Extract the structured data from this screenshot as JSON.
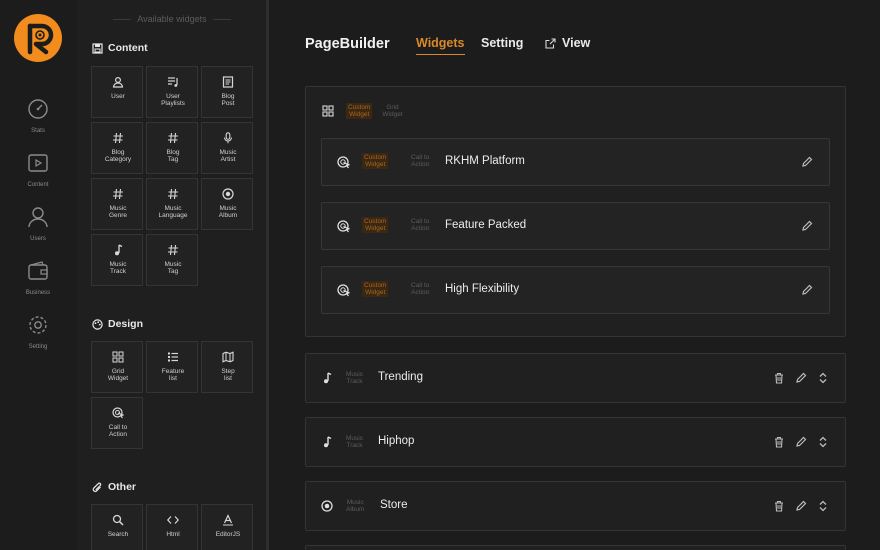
{
  "nav": {
    "items": [
      {
        "label": "Stats",
        "icon": "gauge-icon"
      },
      {
        "label": "Content",
        "icon": "video-icon"
      },
      {
        "label": "Users",
        "icon": "user-icon"
      },
      {
        "label": "Business",
        "icon": "wallet-icon"
      },
      {
        "label": "Setting",
        "icon": "gear-icon"
      }
    ]
  },
  "sidebar": {
    "title": "Available widgets",
    "categories": [
      {
        "label": "Content",
        "tiles": [
          {
            "label": "User",
            "icon": "user-icon"
          },
          {
            "label": "User\nPlaylists",
            "icon": "playlist-icon"
          },
          {
            "label": "Blog\nPost",
            "icon": "newspaper-icon"
          },
          {
            "label": "Blog\nCategory",
            "icon": "hash-icon"
          },
          {
            "label": "Blog\nTag",
            "icon": "hash-icon"
          },
          {
            "label": "Music\nArtist",
            "icon": "mic-icon"
          },
          {
            "label": "Music\nGenre",
            "icon": "hash-icon"
          },
          {
            "label": "Music\nLanguage",
            "icon": "hash-icon"
          },
          {
            "label": "Music\nAlbum",
            "icon": "disc-icon"
          },
          {
            "label": "Music\nTrack",
            "icon": "music-note-icon"
          },
          {
            "label": "Music\nTag",
            "icon": "hash-icon"
          }
        ]
      },
      {
        "label": "Design",
        "tiles": [
          {
            "label": "Grid\nWidget",
            "icon": "grid-icon"
          },
          {
            "label": "Feature\nlist",
            "icon": "list-icon"
          },
          {
            "label": "Step\nlist",
            "icon": "map-icon"
          },
          {
            "label": "Call to\nAction",
            "icon": "cta-icon"
          }
        ]
      },
      {
        "label": "Other",
        "tiles": [
          {
            "label": "Search",
            "icon": "search-icon"
          },
          {
            "label": "Html",
            "icon": "code-icon"
          },
          {
            "label": "EditorJS",
            "icon": "text-icon"
          }
        ]
      }
    ]
  },
  "header": {
    "title": "PageBuilder",
    "tabs": [
      {
        "label": "Widgets",
        "active": true
      },
      {
        "label": "Setting",
        "active": false
      },
      {
        "label": "View",
        "active": false
      }
    ]
  },
  "group": {
    "tag1": "Custom\nWidget",
    "tag2": "Grid\nWidget",
    "items": [
      {
        "tag1": "Custom\nWidget",
        "tag2": "Call to\nAction",
        "name": "RKHM Platform"
      },
      {
        "tag1": "Custom\nWidget",
        "tag2": "Call to\nAction",
        "name": "Feature Packed"
      },
      {
        "tag1": "Custom\nWidget",
        "tag2": "Call to\nAction",
        "name": "High Flexibility"
      }
    ]
  },
  "rows": [
    {
      "tag": "Music\nTrack",
      "name": "Trending",
      "icon": "music-note-icon"
    },
    {
      "tag": "Music\nTrack",
      "name": "Hiphop",
      "icon": "music-note-icon"
    },
    {
      "tag": "Music\nAlbum",
      "name": "Store",
      "icon": "disc-icon"
    }
  ],
  "colors": {
    "accent": "#d9892a",
    "logo": "#f28c1c",
    "background": "#1c1c1c"
  }
}
